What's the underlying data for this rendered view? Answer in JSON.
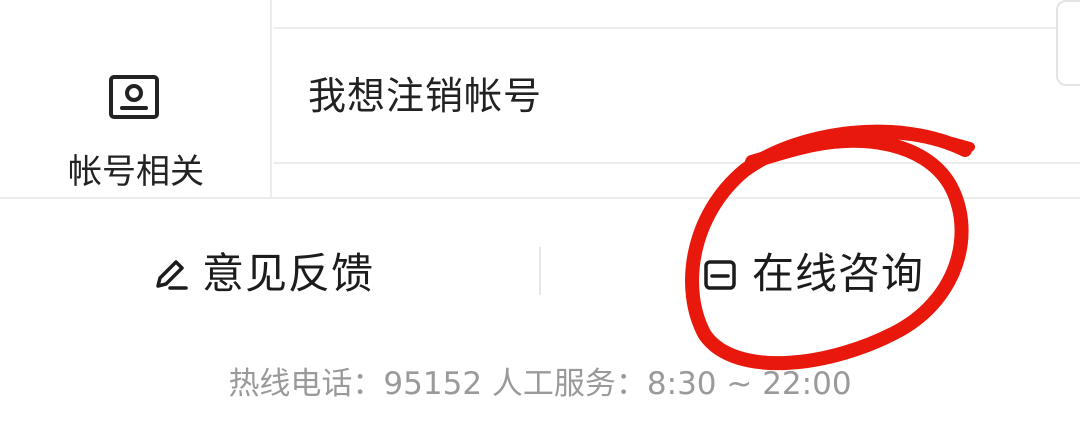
{
  "category": {
    "icon": "account-card-icon",
    "label": "帐号相关"
  },
  "faq": {
    "items": [
      {
        "text": "我想注销帐号"
      }
    ]
  },
  "actions": {
    "feedback": {
      "label": "意见反馈",
      "icon": "pencil-icon"
    },
    "consult": {
      "label": "在线咨询",
      "icon": "chat-bubble-icon"
    }
  },
  "hotline": {
    "text": "热线电话：95152 人工服务：8:30 ~ 22:00"
  },
  "colors": {
    "text_primary": "#222222",
    "text_secondary": "#9a9a9a",
    "divider": "#ececec",
    "annotation_red": "#e8180c"
  }
}
